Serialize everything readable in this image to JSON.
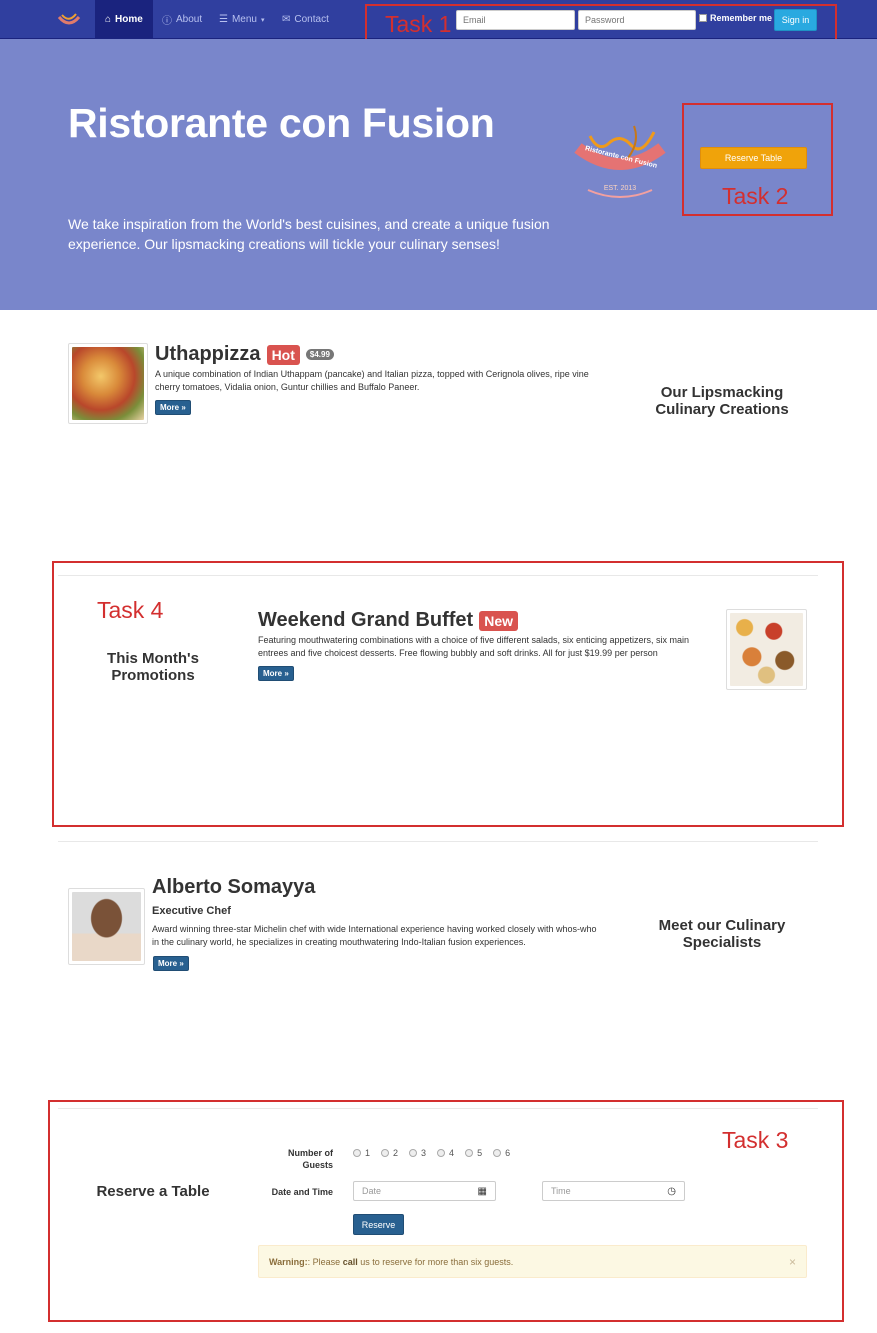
{
  "navbar": {
    "items": [
      {
        "label": "Home",
        "icon": "home-icon"
      },
      {
        "label": "About",
        "icon": "info-icon"
      },
      {
        "label": "Menu",
        "icon": "list-icon"
      },
      {
        "label": "Contact",
        "icon": "envelope-icon"
      }
    ],
    "email_placeholder": "Email",
    "password_placeholder": "Password",
    "remember_label": "Remember me",
    "signin_label": "Sign in"
  },
  "jumbotron": {
    "title": "Ristorante con Fusion",
    "text": "We take inspiration from the World's best cuisines, and create a unique fusion experience. Our lipsmacking creations will tickle your culinary senses!",
    "logo_text": "Ristorante con Fusion",
    "logo_est": "EST. 2013",
    "reserve_label": "Reserve Table"
  },
  "annotations": {
    "task1": "Task 1",
    "task2": "Task 2",
    "task3": "Task 3",
    "task4": "Task 4"
  },
  "dish": {
    "name": "Uthappizza",
    "badge": "Hot",
    "price": "$4.99",
    "description": "A unique combination of Indian Uthappam (pancake) and Italian pizza, topped with Cerignola olives, ripe vine cherry tomatoes, Vidalia onion, Guntur chillies and Buffalo Paneer.",
    "more": "More »",
    "side_heading": "Our Lipsmacking Culinary Creations"
  },
  "promotion": {
    "side_heading": "This Month's Promotions",
    "name": "Weekend Grand Buffet",
    "badge": "New",
    "description": "Featuring mouthwatering combinations with a choice of five different salads, six enticing appetizers, six main entrees and five choicest desserts. Free flowing bubbly and soft drinks. All for just $19.99 per person",
    "more": "More »"
  },
  "leader": {
    "name": "Alberto Somayya",
    "role": "Executive Chef",
    "description": "Award winning three-star Michelin chef with wide International experience having worked closely with whos-who in the culinary world, he specializes in creating mouthwatering Indo-Italian fusion experiences.",
    "more": "More »",
    "side_heading": "Meet our Culinary Specialists"
  },
  "reserve": {
    "side_heading": "Reserve a Table",
    "guests_label": "Number of Guests",
    "guest_options": [
      "1",
      "2",
      "3",
      "4",
      "5",
      "6"
    ],
    "datetime_label": "Date and Time",
    "date_placeholder": "Date",
    "time_placeholder": "Time",
    "submit_label": "Reserve",
    "warning_strong": "Warning:",
    "warning_pre": ": Please ",
    "warning_call": "call",
    "warning_post": " us to reserve for more than six guests.",
    "close": "×"
  }
}
